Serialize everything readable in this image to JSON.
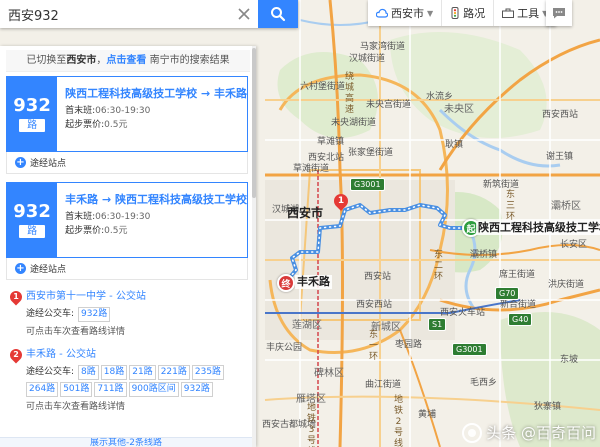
{
  "search": {
    "query": "西安932",
    "clear_icon": "close-icon",
    "button_icon": "search-icon"
  },
  "toolbar": {
    "city": "西安市",
    "traffic": "路况",
    "tools": "工具"
  },
  "notice": {
    "prefix": "已切换至",
    "city": "西安市",
    "sep": "，",
    "link": "点击查看",
    "suffix": "南宁市的搜索结果"
  },
  "routes": [
    {
      "number": "932",
      "unit": "路",
      "title": "陕西工程科技高级技工学校 → 丰禾路",
      "hours_label": "首末班:",
      "hours": "06:30-19:30",
      "fare_label": "起步票价:",
      "fare": "0.5元",
      "add_stop": "途经站点"
    },
    {
      "number": "932",
      "unit": "路",
      "title": "丰禾路 → 陕西工程科技高级技工学校",
      "hours_label": "首末班:",
      "hours": "06:30-19:30",
      "fare_label": "起步票价:",
      "fare": "0.5元",
      "add_stop": "途经站点"
    }
  ],
  "stations": [
    {
      "index": "1",
      "name": "西安市第十一中学 - 公交站",
      "lines_label": "途经公交车:",
      "lines": [
        "932路"
      ],
      "note": "可点击车次查看路线详情"
    },
    {
      "index": "2",
      "name": "丰禾路 - 公交站",
      "lines_label": "途经公交车:",
      "lines": [
        "8路",
        "18路",
        "21路",
        "221路",
        "235路",
        "264路",
        "501路",
        "711路",
        "900路区间",
        "932路"
      ],
      "note": "可点击车次查看路线详情"
    }
  ],
  "more_lines": "展示其他-2条线路",
  "map": {
    "city_label": "西安市",
    "start_marker": "起",
    "end_marker": "终",
    "start_label": "陕西工程科技高级技工学校",
    "end_label": "丰禾路",
    "pin_number": "1",
    "places": [
      "马家湾街道",
      "汉城街道",
      "六村堡街道",
      "未央宫街道",
      "未央湖街道",
      "水流乡",
      "草滩镇",
      "未央区",
      "张家堡街道",
      "草滩街道",
      "西安北站",
      "耿镇",
      "西安西站",
      "灞桥区",
      "新筑街道",
      "谢王镇",
      "长安区",
      "西安站",
      "西安西站",
      "席王街道",
      "灞桥镇",
      "莲湖区",
      "新城区",
      "西安火车站",
      "洪庆街道",
      "新合街道",
      "枣园路",
      "丰庆公园",
      "碑林区",
      "雁塔区",
      "曲江街道",
      "狄寨镇",
      "东坡",
      "汉城湖",
      "西安古都城墙",
      "黄埔",
      "毛西乡"
    ],
    "roads": [
      "绕城高速",
      "东二环",
      "东三环",
      "地铁3号线",
      "地铁2号线",
      "东一环",
      "G3001",
      "G70",
      "G40",
      "S1"
    ],
    "watermark": "头条 @百奇百问"
  },
  "colors": {
    "accent": "#3385ff",
    "route": "#4a90e2",
    "pin": "#e53935",
    "start": "#2e9e3f"
  }
}
